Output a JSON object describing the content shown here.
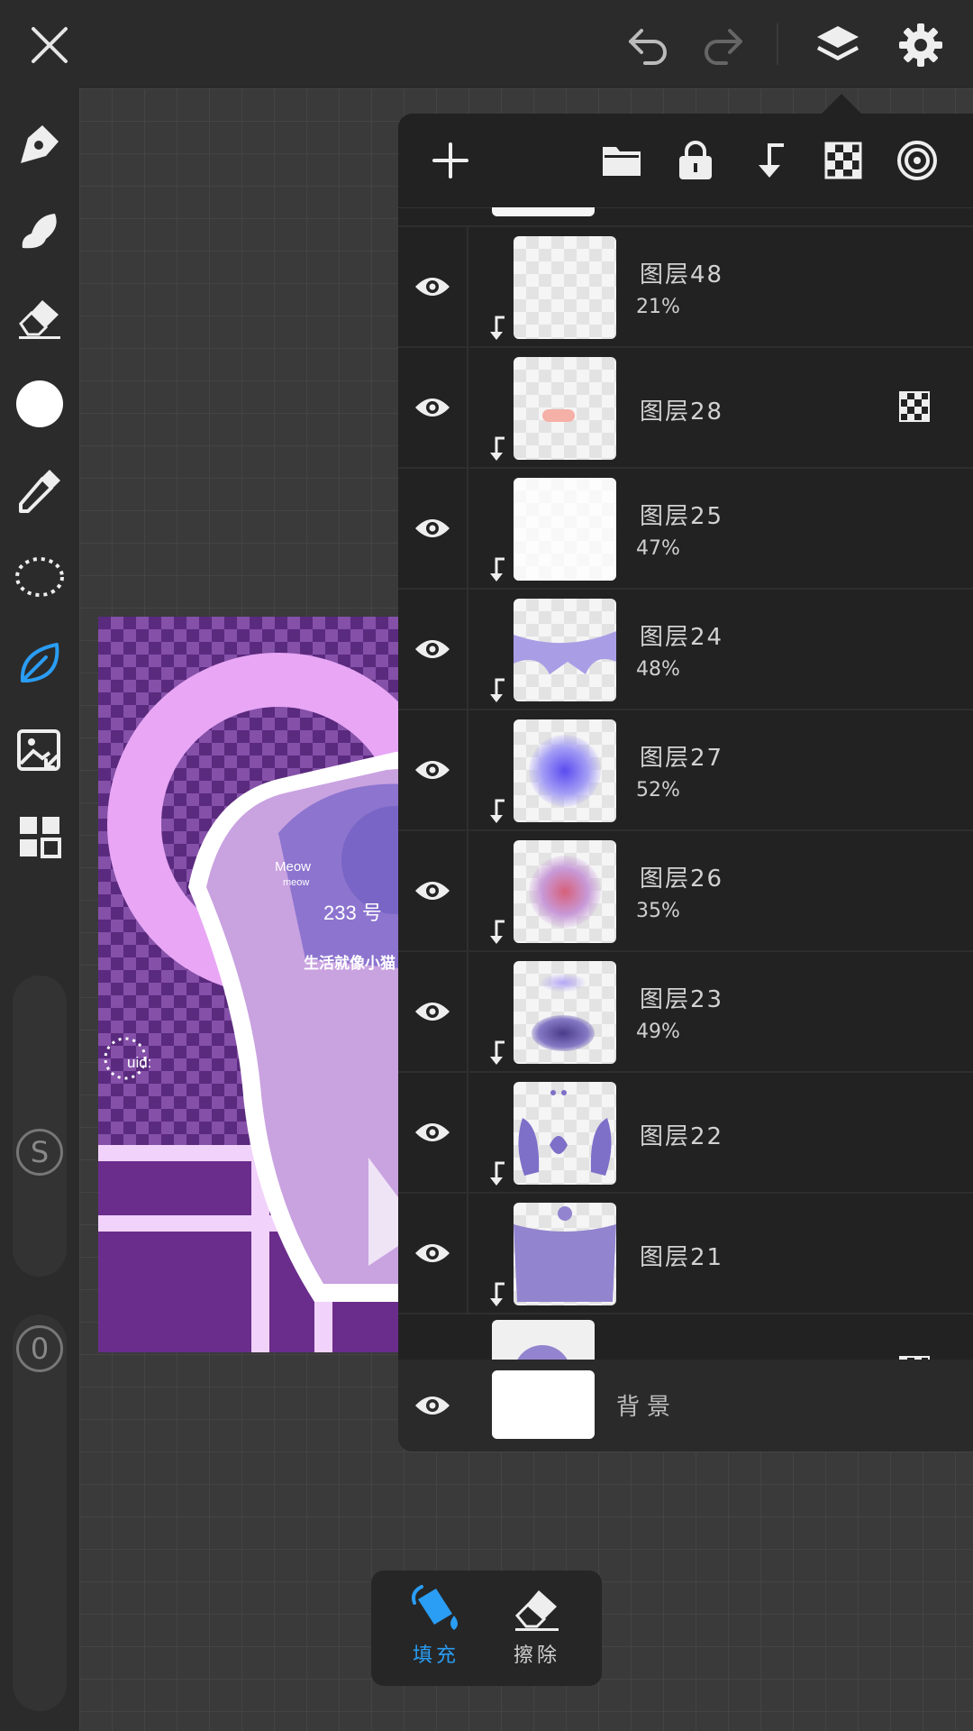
{
  "topbar": {
    "close_icon": "close-icon",
    "undo_icon": "undo-icon",
    "redo_icon": "redo-icon",
    "layers_icon": "layers-icon",
    "settings_icon": "gear-icon"
  },
  "tools": [
    "pen",
    "brush",
    "eraser",
    "color",
    "eyedropper",
    "lasso",
    "leaf-selected",
    "image-import",
    "grid"
  ],
  "sliders": {
    "size_label": "S",
    "opacity_label": "0"
  },
  "artwork": {
    "texts": [
      "Meow",
      "meow",
      "233 号",
      "生活就像小猫",
      "uid:"
    ]
  },
  "layer_panel": {
    "layers": [
      {
        "name": "图层48",
        "opacity": "21%",
        "clipped": true,
        "tag": false
      },
      {
        "name": "图层28",
        "opacity": "",
        "clipped": true,
        "tag": true
      },
      {
        "name": "图层25",
        "opacity": "47%",
        "clipped": true,
        "tag": false
      },
      {
        "name": "图层24",
        "opacity": "48%",
        "clipped": true,
        "tag": false
      },
      {
        "name": "图层27",
        "opacity": "52%",
        "clipped": true,
        "tag": false
      },
      {
        "name": "图层26",
        "opacity": "35%",
        "clipped": true,
        "tag": false
      },
      {
        "name": "图层23",
        "opacity": "49%",
        "clipped": true,
        "tag": false
      },
      {
        "name": "图层22",
        "opacity": "",
        "clipped": true,
        "tag": false
      },
      {
        "name": "图层21",
        "opacity": "",
        "clipped": true,
        "tag": false
      }
    ],
    "background_layer": "背景"
  },
  "bottom_tools": {
    "fill_label": "填充",
    "erase_label": "擦除"
  },
  "colors": {
    "accent": "#2a9df4",
    "panel": "#232223"
  }
}
